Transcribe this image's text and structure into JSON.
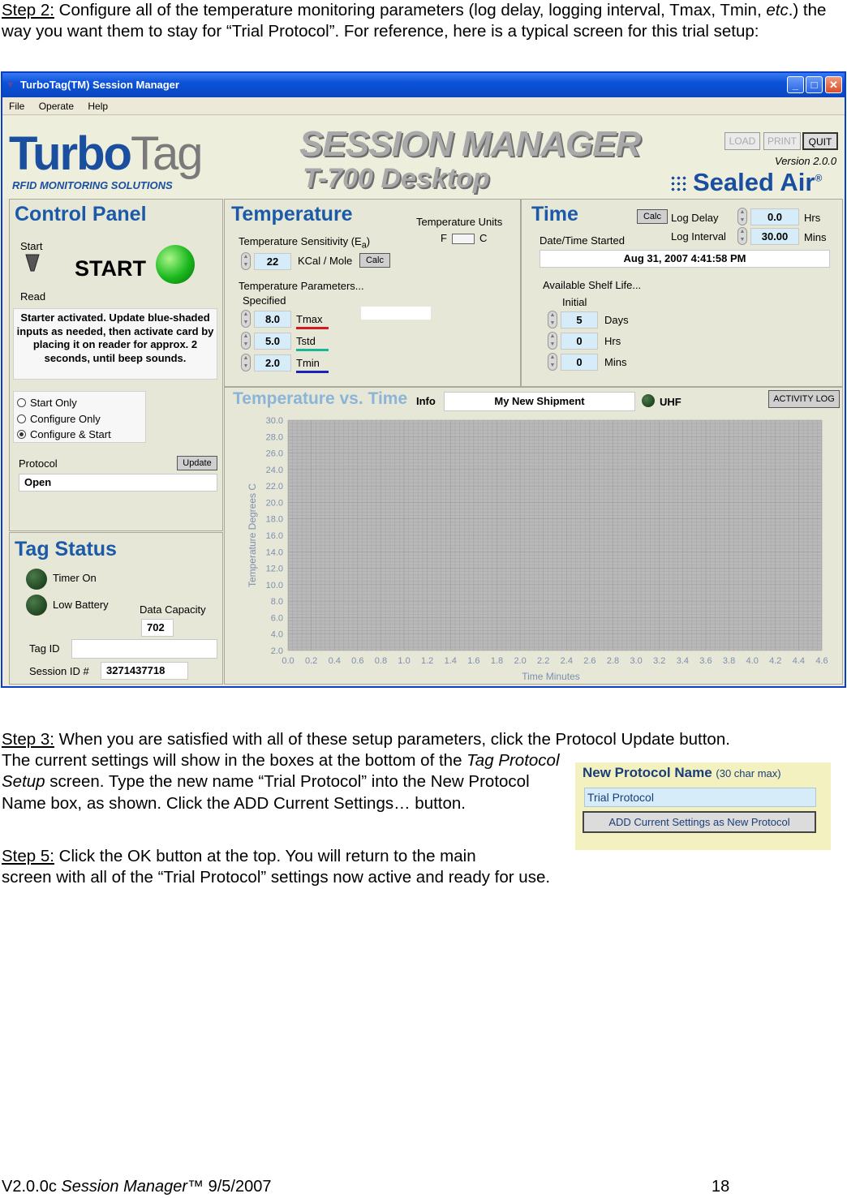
{
  "step2": {
    "label": "Step 2:",
    "text_a": " Configure all of the temperature monitoring parameters (log delay, logging interval, Tmax, Tmin, ",
    "text_italic": "etc",
    "text_b": ".) the way you want them to stay for “Trial Protocol”.  For reference, here is a typical screen for this trial setup:"
  },
  "window": {
    "title": "TurboTag(TM) Session Manager",
    "menu": [
      "File",
      "Operate",
      "Help"
    ]
  },
  "header": {
    "logo_a": "Turbo",
    "logo_b": "Tag",
    "logo_sub": "RFID MONITORING SOLUTIONS",
    "title": "SESSION MANAGER",
    "subtitle": "T-700 Desktop",
    "btn_load": "LOAD",
    "btn_print": "PRINT",
    "btn_quit": "QUIT",
    "version": "Version 2.0.0",
    "brand": "Sealed Air",
    "brand_mark": "®"
  },
  "control_panel": {
    "title": "Control Panel",
    "start_label": "Start",
    "start_text": "START",
    "read_label": "Read",
    "message": "Starter activated. Update blue-shaded inputs as needed, then activate card by placing it on reader for approx. 2 seconds, until beep sounds.",
    "modes": [
      "Start Only",
      "Configure Only",
      "Configure & Start"
    ],
    "protocol_label": "Protocol",
    "update_btn": "Update",
    "protocol_value": "Open"
  },
  "tag_status": {
    "title": "Tag Status",
    "timer_on": "Timer On",
    "low_battery": "Low Battery",
    "data_capacity_label": "Data Capacity",
    "data_capacity_value": "702",
    "tag_id_label": "Tag ID",
    "tag_id_value": "",
    "session_label": "Session ID #",
    "session_value": "3271437718"
  },
  "temperature": {
    "title": "Temperature",
    "units_label": "Temperature Units",
    "unit_f": "F",
    "unit_c": "C",
    "sensitivity_label_a": "Temperature Sensitivity (E",
    "sensitivity_label_sub": "a",
    "sensitivity_label_b": ")",
    "sensitivity_value": "22",
    "sensitivity_unit": "KCal / Mole",
    "calc_btn": "Calc",
    "params_label": "Temperature Parameters...",
    "specified_label": "Specified",
    "tmax_value": "8.0",
    "tmax_label": "Tmax",
    "tmax_color": "#d01c1c",
    "tstd_value": "5.0",
    "tstd_label": "Tstd",
    "tstd_color": "#19b59a",
    "tmin_value": "2.0",
    "tmin_label": "Tmin",
    "tmin_color": "#1a22b8"
  },
  "time": {
    "title": "Time",
    "calc_btn": "Calc",
    "log_delay_label": "Log Delay",
    "log_delay_value": "0.0",
    "log_delay_unit": "Hrs",
    "log_interval_label": "Log Interval",
    "log_interval_value": "30.00",
    "log_interval_unit": "Mins",
    "started_label": "Date/Time Started",
    "started_value": "Aug 31, 2007  4:41:58 PM",
    "shelf_label": "Available Shelf Life...",
    "initial_label": "Initial",
    "days_value": "5",
    "days_unit": "Days",
    "hrs_value": "0",
    "hrs_unit": "Hrs",
    "mins_value": "0",
    "mins_unit": "Mins"
  },
  "chart_panel": {
    "title": "Temperature vs. Time",
    "info_label": "Info",
    "info_value": "My New Shipment",
    "uhf_label": "UHF",
    "activity_btn": "ACTIVITY LOG"
  },
  "chart_data": {
    "type": "line",
    "title": "",
    "xlabel": "Time Minutes",
    "ylabel": "Temperature Degrees C",
    "xlim": [
      0.0,
      4.6
    ],
    "ylim": [
      2.0,
      30.0
    ],
    "x_ticks": [
      "0.0",
      "0.2",
      "0.4",
      "0.6",
      "0.8",
      "1.0",
      "1.2",
      "1.4",
      "1.6",
      "1.8",
      "2.0",
      "2.2",
      "2.4",
      "2.6",
      "2.8",
      "3.0",
      "3.2",
      "3.4",
      "3.6",
      "3.8",
      "4.0",
      "4.2",
      "4.4",
      "4.6"
    ],
    "y_ticks": [
      "30.0",
      "28.0",
      "26.0",
      "24.0",
      "22.0",
      "20.0",
      "18.0",
      "16.0",
      "14.0",
      "12.0",
      "10.0",
      "8.0",
      "6.0",
      "4.0",
      "2.0"
    ],
    "grid": true,
    "series": []
  },
  "step3": {
    "label": "Step 3:",
    "text": " When you are satisfied with all of these setup parameters, click the Protocol Update button.",
    "text2_a": "The current settings will show in the boxes at the bottom of the ",
    "text2_italic": "Tag Protocol Setup",
    "text2_b": " screen.  Type the new name “Trial Protocol” into the New Protocol Name box, as shown.  Click the ADD Current Settings… button."
  },
  "new_protocol": {
    "title": "New Protocol Name",
    "hint": "(30 char max)",
    "value": "Trial Protocol",
    "add_btn": "ADD Current Settings as New Protocol"
  },
  "step5": {
    "label": "Step 5:",
    "text_a": " Click the OK button at the top.  You will return to the main",
    "text_b": "screen with all of the “Trial Protocol” settings now active and ready for use."
  },
  "footer": {
    "version": "V2.0.0c ",
    "product": "Session Manager",
    "tm": "™",
    "date": " 9/5/2007",
    "page": "18"
  }
}
